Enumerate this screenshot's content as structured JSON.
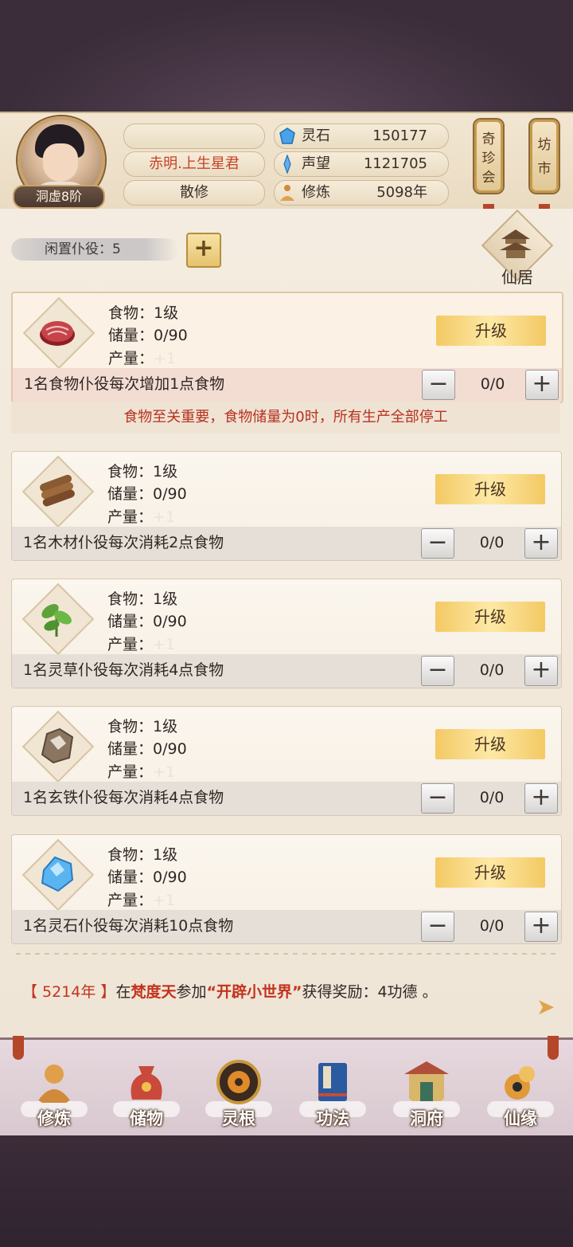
{
  "player": {
    "rank": "洞虚8阶",
    "title": "赤明.上生星君",
    "sect": "散修"
  },
  "stats": [
    {
      "label": "灵石",
      "value": "150177",
      "icon": "spirit-stone-icon"
    },
    {
      "label": "声望",
      "value": "1121705",
      "icon": "reputation-icon"
    },
    {
      "label": "修炼",
      "value": "5098年",
      "icon": "cultivation-icon"
    }
  ],
  "side_buttons": {
    "treasure": "奇\n珍\n会",
    "market": "坊\n市"
  },
  "idle": {
    "label": "闲置仆役：5",
    "plus": "+"
  },
  "residence": {
    "label": "仙居"
  },
  "cards": [
    {
      "level": "食物：1级",
      "storage": "储量：0/90",
      "output_label": "产量：",
      "output_value": "+1",
      "upgrade": "升级",
      "desc": "1名食物仆役每次增加1点食物",
      "count": "0/0",
      "icon": "meat-icon"
    },
    {
      "level": "食物：1级",
      "storage": "储量：0/90",
      "output_label": "产量：",
      "output_value": "+1",
      "upgrade": "升级",
      "desc": "1名木材仆役每次消耗2点食物",
      "count": "0/0",
      "icon": "wood-icon"
    },
    {
      "level": "食物：1级",
      "storage": "储量：0/90",
      "output_label": "产量：",
      "output_value": "+1",
      "upgrade": "升级",
      "desc": "1名灵草仆役每次消耗4点食物",
      "count": "0/0",
      "icon": "herb-icon"
    },
    {
      "level": "食物：1级",
      "storage": "储量：0/90",
      "output_label": "产量：",
      "output_value": "+1",
      "upgrade": "升级",
      "desc": "1名玄铁仆役每次消耗4点食物",
      "count": "0/0",
      "icon": "iron-ore-icon"
    },
    {
      "level": "食物：1级",
      "storage": "储量：0/90",
      "output_label": "产量：",
      "output_value": "+1",
      "upgrade": "升级",
      "desc": "1名灵石仆役每次消耗10点食物",
      "count": "0/0",
      "icon": "crystal-icon"
    }
  ],
  "warning": "食物至关重要，食物储量为0时，所有生产全部停工",
  "news": {
    "year": "【 5214年 】",
    "part1": "在",
    "place": "梵度天",
    "part2": "参加",
    "event": "“开辟小世界”",
    "part3": "获得奖励：4功德 。"
  },
  "nav": [
    {
      "label": "修炼",
      "icon": "cultivate-icon"
    },
    {
      "label": "储物",
      "icon": "storage-bag-icon"
    },
    {
      "label": "灵根",
      "icon": "spirit-root-icon"
    },
    {
      "label": "功法",
      "icon": "technique-book-icon"
    },
    {
      "label": "洞府",
      "icon": "cave-palace-icon"
    },
    {
      "label": "仙缘",
      "icon": "immortal-fate-icon"
    }
  ],
  "colors": {
    "accent_red": "#c3331e",
    "gold_button": "#f3c963"
  }
}
